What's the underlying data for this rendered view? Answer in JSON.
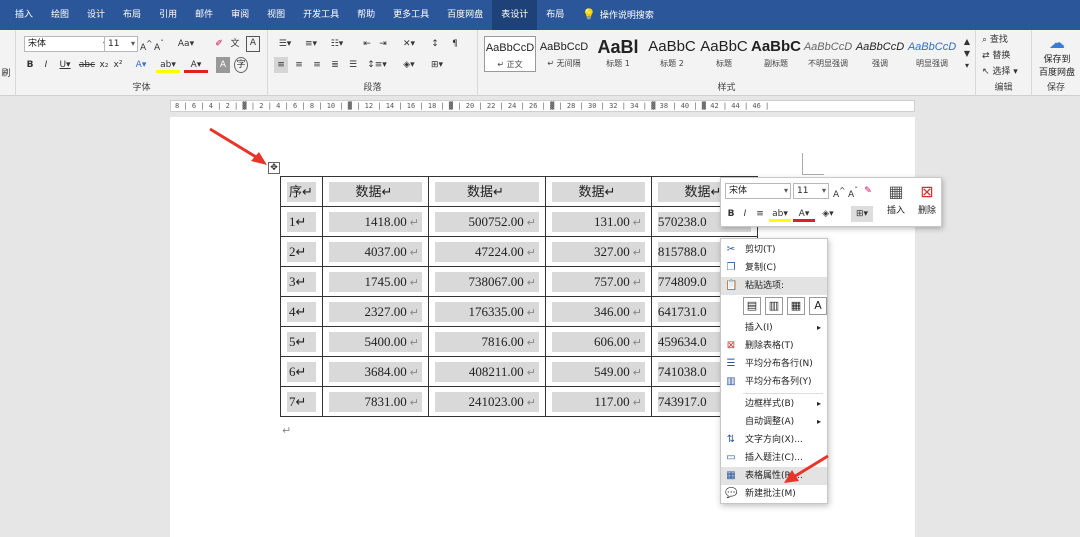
{
  "tabs": [
    "插入",
    "绘图",
    "设计",
    "布局",
    "引用",
    "邮件",
    "审阅",
    "视图",
    "开发工具",
    "帮助",
    "更多工具",
    "百度网盘",
    "表设计",
    "布局"
  ],
  "tell_me": "操作说明搜索",
  "ribbon": {
    "font_name": "宋体",
    "font_size": "11",
    "font_group_label": "字体",
    "paragraph_group_label": "段落",
    "styles_group_label": "样式",
    "edit_group_label": "编辑",
    "save_group_label": "保存",
    "styles": [
      {
        "preview": "AaBbCcD",
        "name": "↵ 正文"
      },
      {
        "preview": "AaBbCcD",
        "name": "↵ 无间隔"
      },
      {
        "preview": "AaBl",
        "name": "标题 1"
      },
      {
        "preview": "AaBbC",
        "name": "标题 2"
      },
      {
        "preview": "AaBbC",
        "name": "标题"
      },
      {
        "preview": "AaBbC",
        "name": "副标题"
      },
      {
        "preview": "AaBbCcD",
        "name": "不明显强调"
      },
      {
        "preview": "AaBbCcD",
        "name": "强调"
      },
      {
        "preview": "AaBbCcD",
        "name": "明显强调"
      }
    ],
    "find": "查找",
    "replace": "替换",
    "select": "选择",
    "save_baidu_1": "保存到",
    "save_baidu_2": "百度网盘",
    "left_edge": "刷"
  },
  "ruler_text": "8 | 6 | 4 | 2 | ▓ | 2 | 4 | 6 | 8 | 10 | ▓ | 12 | 14 | 16 | 18 | ▓ | 20 | 22 | 24 | 26 | ▓ | 28 | 30 | 32 | 34 | ▓ 38 | 40 | ▓ 42 | 44 | 46 |",
  "table": {
    "header": [
      "序↵",
      "数据↵",
      "数据↵",
      "数据↵",
      "数据↵"
    ],
    "rows": [
      [
        "1↵",
        "1418.00",
        "500752.00",
        "131.00",
        "570238.0"
      ],
      [
        "2↵",
        "4037.00",
        "47224.00",
        "327.00",
        "815788.0"
      ],
      [
        "3↵",
        "1745.00",
        "738067.00",
        "757.00",
        "774809.0"
      ],
      [
        "4↵",
        "2327.00",
        "176335.00",
        "346.00",
        "641731.0"
      ],
      [
        "5↵",
        "5400.00",
        "7816.00",
        "606.00",
        "459634.0"
      ],
      [
        "6↵",
        "3684.00",
        "408211.00",
        "549.00",
        "741038.0"
      ],
      [
        "7↵",
        "7831.00",
        "241023.00",
        "117.00",
        "743917.0"
      ]
    ],
    "return_mark": "↵",
    "after_mark": "↵"
  },
  "mini_toolbar": {
    "font": "宋体",
    "size": "11",
    "insert_label": "插入",
    "delete_label": "删除"
  },
  "context_menu": {
    "cut": "剪切(T)",
    "copy": "复制(C)",
    "paste_options": "粘贴选项:",
    "insert": "插入(I)",
    "delete_table": "删除表格(T)",
    "distribute_rows": "平均分布各行(N)",
    "distribute_cols": "平均分布各列(Y)",
    "border_styles": "边框样式(B)",
    "autofit": "自动调整(A)",
    "text_direction": "文字方向(X)...",
    "insert_caption": "插入题注(C)...",
    "table_properties": "表格属性(R)...",
    "new_comment": "新建批注(M)"
  },
  "colors": {
    "title_bar": "#2b579a",
    "highlight_yellow": "#ffff00",
    "font_red": "#e02020",
    "arrow_red": "#e8352b"
  }
}
